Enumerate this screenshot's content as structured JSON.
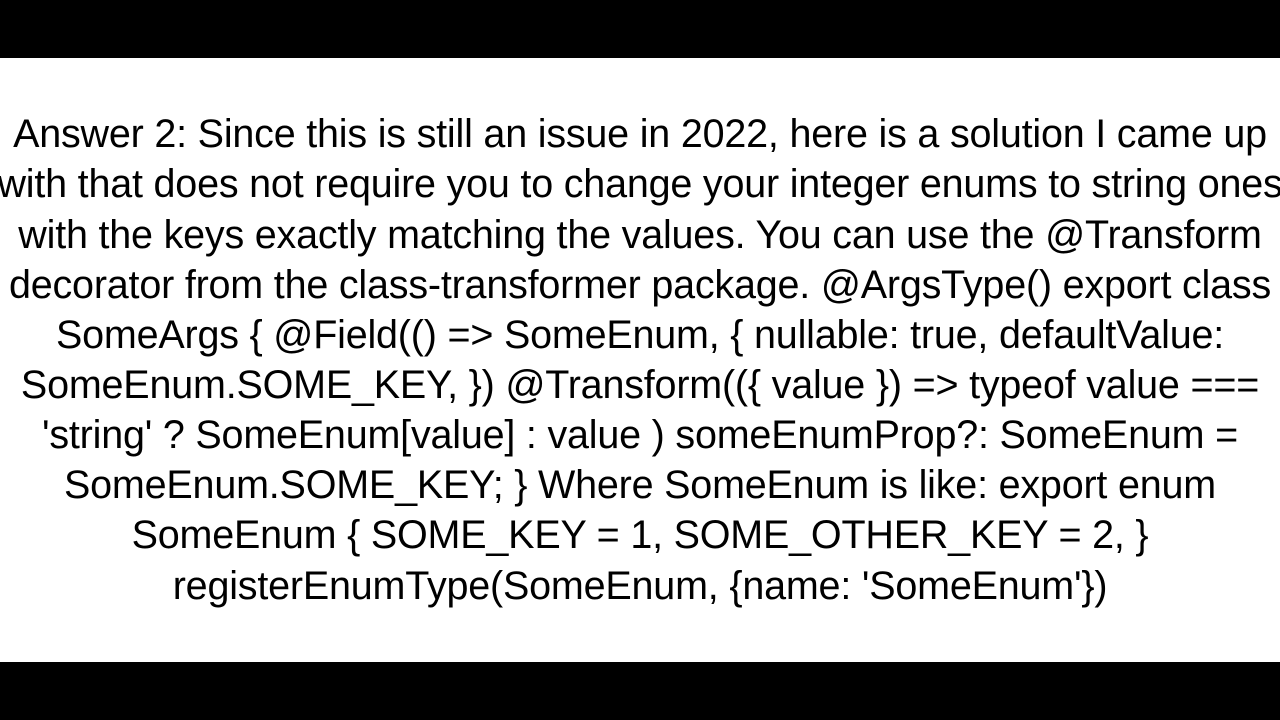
{
  "document": {
    "text": "Answer 2: Since this is still an issue in 2022, here is a solution I came up with that does not require you to change your integer enums to string ones with the keys exactly matching the values. You can use the @Transform decorator from the class-transformer package. @ArgsType() export class SomeArgs {   @Field(() => SomeEnum, {     nullable: true,     defaultValue: SomeEnum.SOME_KEY,   })   @Transform(({ value }) =>      typeof value === 'string' ? SomeEnum[value] : value   )   someEnumProp?: SomeEnum = SomeEnum.SOME_KEY; }  Where SomeEnum is like: export enum SomeEnum {   SOME_KEY = 1,    SOME_OTHER_KEY = 2,  }  registerEnumType(SomeEnum, {name: 'SomeEnum'})"
  }
}
